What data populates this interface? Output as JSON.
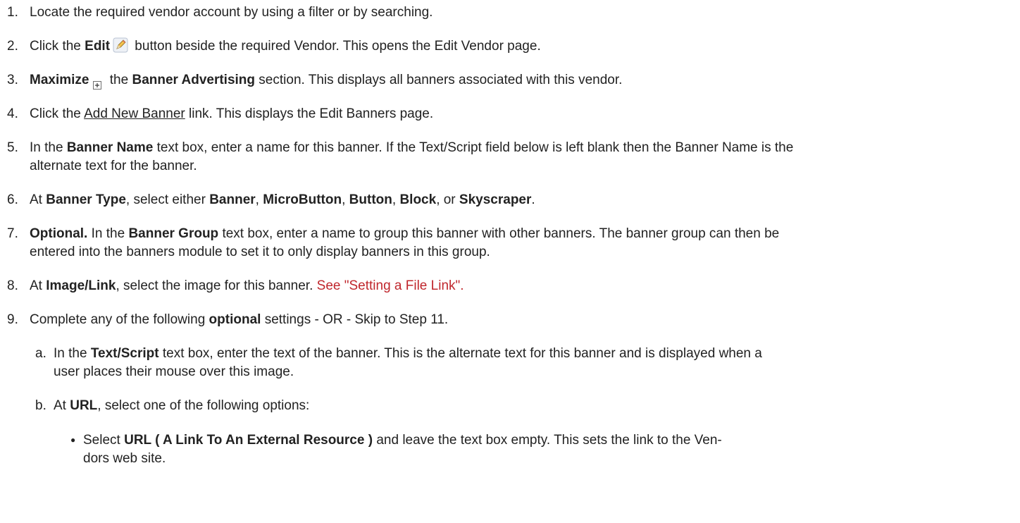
{
  "steps": [
    {
      "num": "1.",
      "text": "Locate the required vendor account by using a filter or by searching."
    },
    {
      "num": "2.",
      "pre": "Click the ",
      "bold": "Edit",
      "post": " button beside the required Vendor. This opens the Edit Vendor page."
    },
    {
      "num": "3.",
      "bold1": "Maximize",
      "mid": " the ",
      "bold2": "Banner Advertising",
      "post": " section. This displays all banners associated with this vendor."
    },
    {
      "num": "4.",
      "pre": "Click the ",
      "link": "Add New Banner",
      "post": " link. This displays the Edit Banners page."
    },
    {
      "num": "5.",
      "pre": "In the ",
      "bold": "Banner Name",
      "post": " text box, enter a name for this banner. If the Text/Script field below is left blank then the Banner Name is the",
      "line2": "alternate text for the banner."
    },
    {
      "num": "6.",
      "pre": "At ",
      "b1": "Banner Type",
      "t1": ", select either ",
      "b2": "Banner",
      "t2": ", ",
      "b3": "MicroButton",
      "t3": ", ",
      "b4": "Button",
      "t4": ", ",
      "b5": "Block",
      "t5": ", or ",
      "b6": "Skyscraper",
      "t6": "."
    },
    {
      "num": "7.",
      "bold1": "Optional.",
      "mid": " In the ",
      "bold2": "Banner Group",
      "post": " text box, enter a name to group this banner with other banners. The banner group can then be",
      "line2": "entered into the banners module to set it to only display banners in this group."
    },
    {
      "num": "8.",
      "pre": "At ",
      "bold": "Image/Link",
      "post": ", select the image for this banner. ",
      "link": "See \"Setting a File Link\"."
    },
    {
      "num": "9.",
      "pre": "Complete any of the following ",
      "bold": "optional",
      "post": " settings - OR - Skip to Step 11."
    }
  ],
  "substeps": [
    {
      "num": "a.",
      "pre": "In the ",
      "bold": "Text/Script",
      "post": " text box, enter the text of the banner. This is the alternate text for this banner and is displayed when a",
      "line2": "user places their mouse over this image."
    },
    {
      "num": "b.",
      "pre": "At ",
      "bold": "URL",
      "post": ", select one of the following options:"
    }
  ],
  "bullets": [
    {
      "symbol": "●",
      "pre": "Select ",
      "bold": "URL ( A Link To An External Resource )",
      "post": " and leave the text box empty. This sets the link to the Ven-",
      "line2": "dors web site."
    }
  ],
  "icons": {
    "edit": "pencil-edit-icon",
    "maximize": "plus-box-icon"
  }
}
